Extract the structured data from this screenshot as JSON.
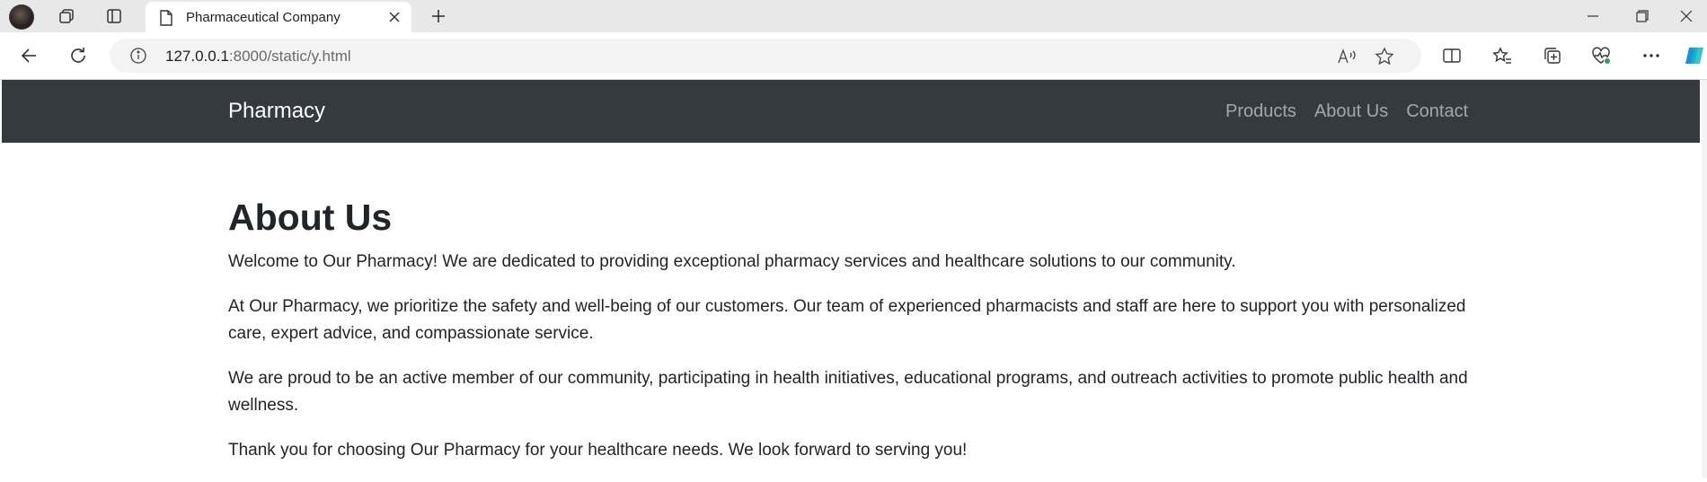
{
  "browser": {
    "tab_title": "Pharmaceutical Company",
    "url_host": "127.0.0.1",
    "url_rest": ":8000/static/y.html"
  },
  "navbar": {
    "brand": "Pharmacy",
    "links": [
      "Products",
      "About Us",
      "Contact"
    ]
  },
  "main": {
    "heading": "About Us",
    "paragraphs": [
      "Welcome to Our Pharmacy! We are dedicated to providing exceptional pharmacy services and healthcare solutions to our community.",
      "At Our Pharmacy, we prioritize the safety and well-being of our customers. Our team of experienced pharmacists and staff are here to support you with personalized care, expert advice, and compassionate service.",
      "We are proud to be an active member of our community, participating in health initiatives, educational programs, and outreach activities to promote public health and wellness.",
      "Thank you for choosing Our Pharmacy for your healthcare needs. We look forward to serving you!"
    ]
  },
  "icons": {
    "tab_favicon": "page-icon",
    "new_tab": "plus-icon",
    "info": "info-icon",
    "read_aloud": "read-aloud-icon",
    "favorite": "star-icon"
  },
  "colors": {
    "navbar_bg": "#343a40",
    "text": "#212529",
    "nav_link": "rgba(255,255,255,0.55)"
  }
}
